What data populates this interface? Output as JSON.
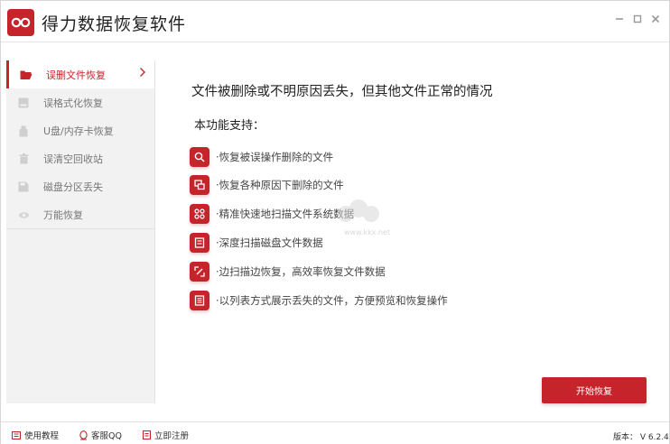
{
  "app": {
    "title": "得力数据恢复软件",
    "accent": "#c5242b"
  },
  "window_controls": {
    "minimize_icon": "minimize-icon",
    "maximize_icon": "maximize-icon",
    "close_icon": "close-icon"
  },
  "sidebar": {
    "items": [
      {
        "label": "误删文件恢复",
        "icon": "folder-open-icon",
        "active": true
      },
      {
        "label": "误格式化恢复",
        "icon": "drive-icon",
        "active": false
      },
      {
        "label": "U盘/内存卡恢复",
        "icon": "usb-icon",
        "active": false
      },
      {
        "label": "误清空回收站",
        "icon": "trash-icon",
        "active": false
      },
      {
        "label": "磁盘分区丢失",
        "icon": "disk-icon",
        "active": false
      },
      {
        "label": "万能恢复",
        "icon": "eye-icon",
        "active": false
      }
    ]
  },
  "main": {
    "headline": "文件被删除或不明原因丢失，但其他文件正常的情况",
    "subhead": "本功能支持：",
    "features": [
      {
        "text": "·恢复被误操作删除的文件",
        "icon": "search-icon"
      },
      {
        "text": "·恢复各种原因下删除的文件",
        "icon": "copy-icon"
      },
      {
        "text": "·精准快速地扫描文件系统数据",
        "icon": "grid-icon"
      },
      {
        "text": "·深度扫描磁盘文件数据",
        "icon": "deep-scan-icon"
      },
      {
        "text": "·边扫描边恢复，高效率恢复文件数据",
        "icon": "expand-icon"
      },
      {
        "text": "·以列表方式展示丢失的文件，方便预览和恢复操作",
        "icon": "list-icon"
      }
    ],
    "start_button": "开始恢复",
    "watermark": "www.kkx.net"
  },
  "footer": {
    "tutorial": "使用教程",
    "support_qq": "客服QQ",
    "register": "立即注册",
    "version": "版本： V 6.2.4"
  }
}
